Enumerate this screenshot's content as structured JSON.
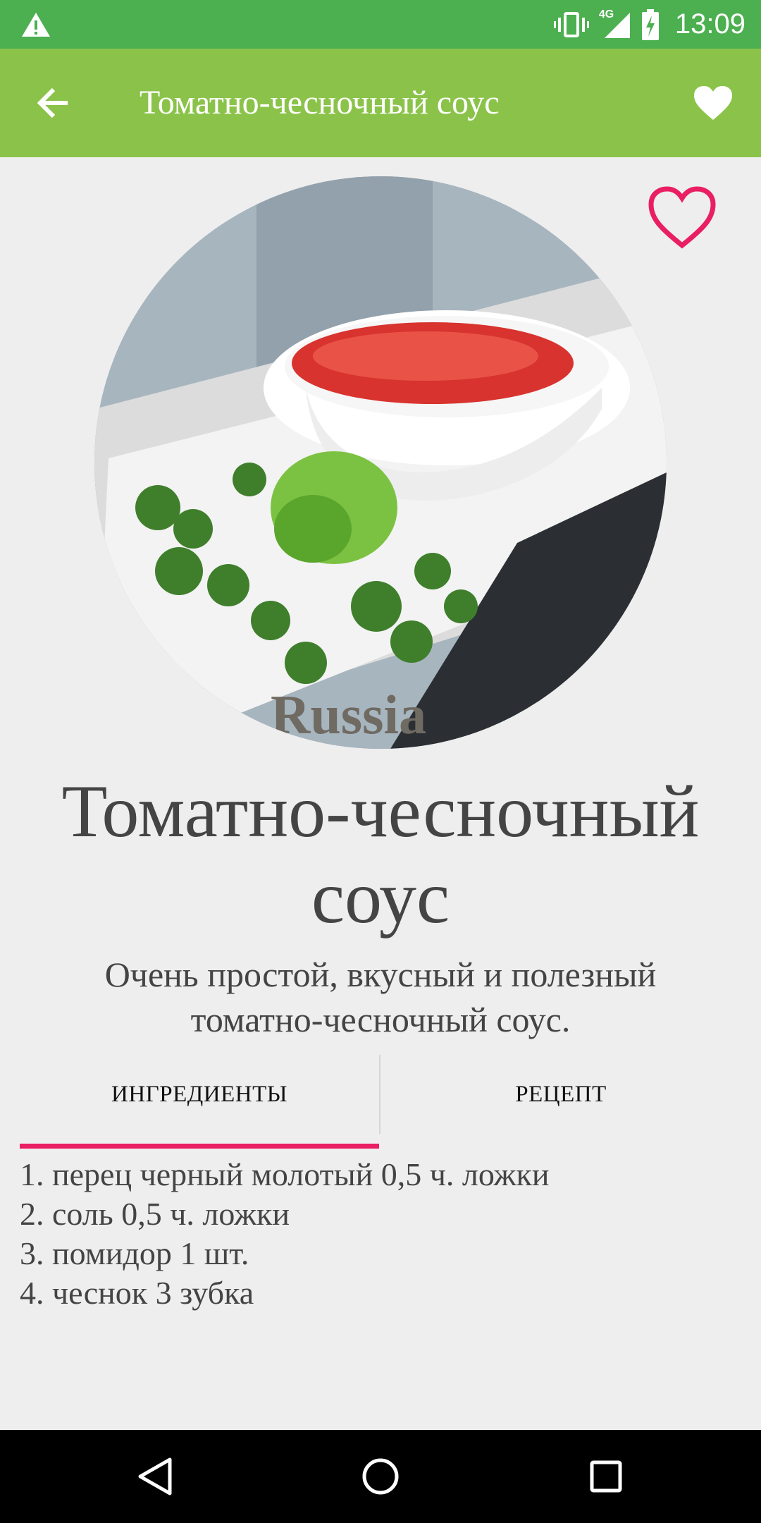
{
  "status_bar": {
    "network": "4G",
    "time": "13:09",
    "icons": [
      "warning-icon",
      "vibrate-icon",
      "signal-icon",
      "battery-charging-icon"
    ]
  },
  "app_bar": {
    "title": "Томатно-чесночный соус",
    "back_icon": "arrow-back-icon",
    "favorite_icon": "heart-filled-icon",
    "color": "#8bc34a"
  },
  "recipe": {
    "title": "Томатно-чесночный соус",
    "description": "Очень простой, вкусный и полезный томатно-чесночный соус.",
    "favorite_icon": "heart-outline-icon",
    "photo_watermark": "Russia"
  },
  "tabs": {
    "items": [
      {
        "label": "ИНГРЕДИЕНТЫ",
        "selected": true
      },
      {
        "label": "РЕЦЕПТ",
        "selected": false
      }
    ],
    "indicator_color": "#e91e63"
  },
  "ingredients": [
    "1. перец черный молотый 0,5 ч. ложки",
    "2. соль 0,5 ч. ложки",
    "3. помидор 1 шт.",
    "4. чеснок 3 зубка"
  ],
  "nav_bar": {
    "icons": [
      "nav-back-icon",
      "nav-home-icon",
      "nav-recents-icon"
    ]
  }
}
